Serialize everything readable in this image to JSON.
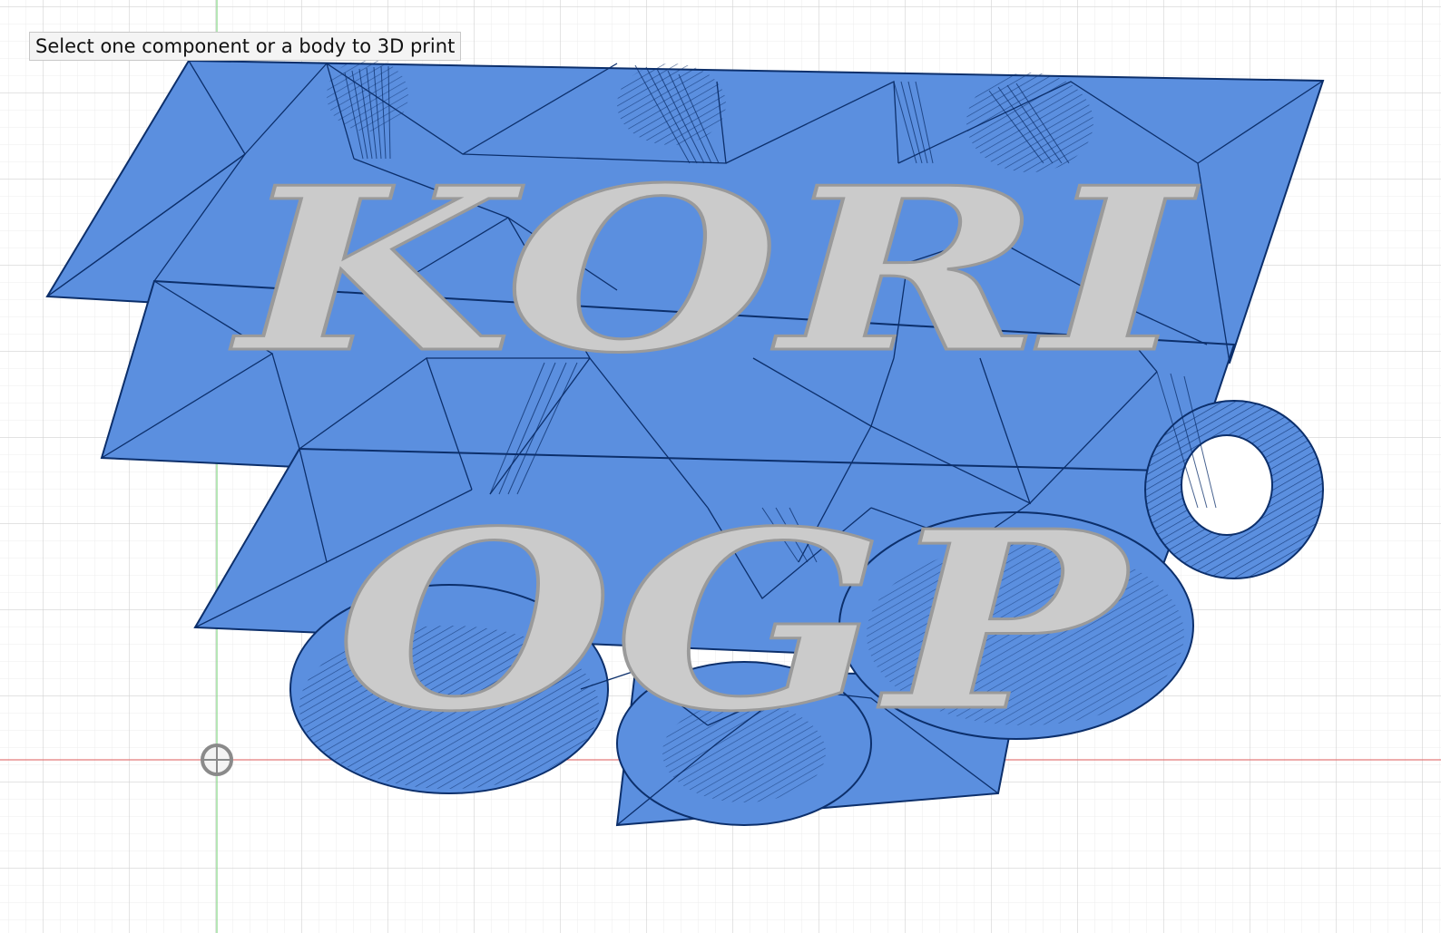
{
  "tooltip": {
    "text": "Select one component or a body to 3D print"
  },
  "model": {
    "line1": "KORI",
    "line2": "OGP",
    "body_color": "#5b8fdf",
    "mesh_color": "#0c2f6b",
    "letter_color": "#cbcbcb",
    "letter_outline": "#9a9a9a"
  },
  "grid": {
    "minor_color": "#ececec",
    "major_color": "#d2d2d2",
    "x_axis_color": "#e47a7a",
    "y_axis_color": "#8fd98f"
  },
  "icons": {
    "origin": "origin-marker-icon"
  }
}
